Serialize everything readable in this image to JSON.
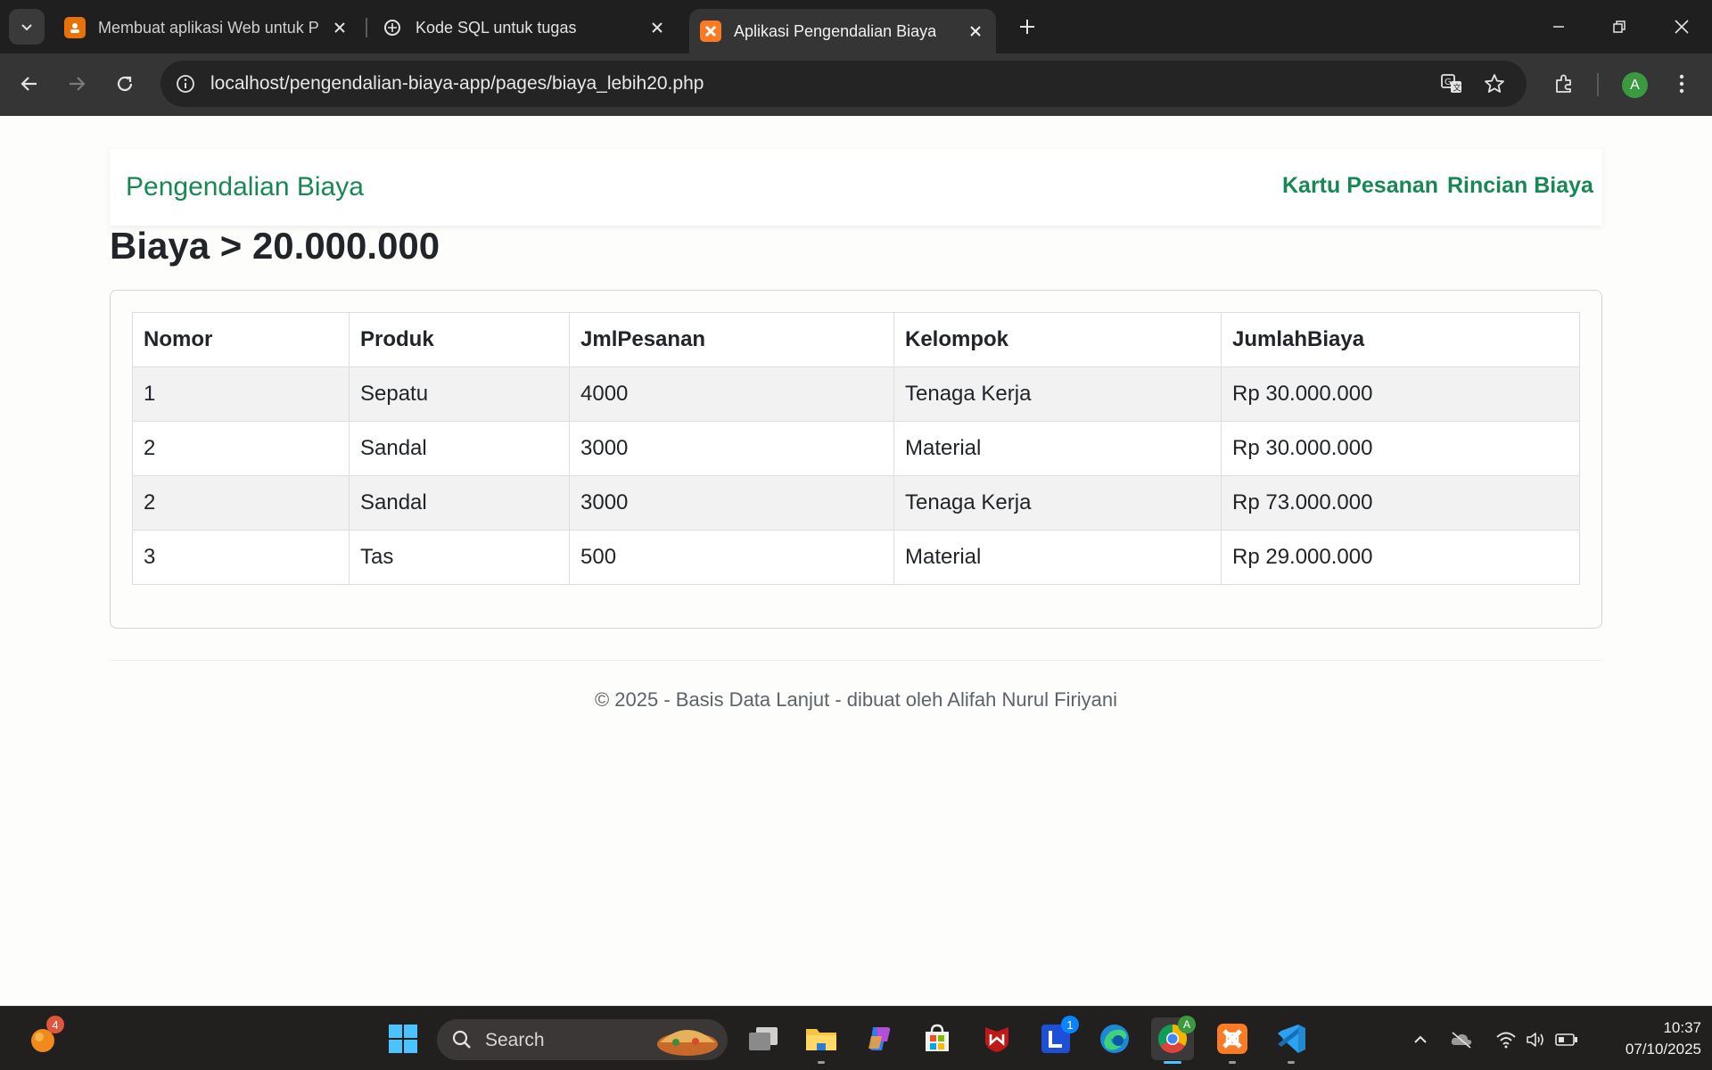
{
  "browser": {
    "tabs": [
      {
        "title": "Membuat aplikasi Web untuk P",
        "favicon": "slides-icon",
        "active": false
      },
      {
        "title": "Kode SQL untuk tugas",
        "favicon": "chatgpt-icon",
        "active": false
      },
      {
        "title": "Aplikasi Pengendalian Biaya",
        "favicon": "xampp-icon",
        "active": true
      }
    ],
    "url": "localhost/pengendalian-biaya-app/pages/biaya_lebih20.php",
    "profile_initial": "A"
  },
  "page": {
    "brand": "Pengendalian Biaya",
    "nav": [
      "Kartu Pesanan",
      "Rincian Biaya"
    ],
    "title": "Biaya > 20.000.000",
    "table": {
      "headers": [
        "Nomor",
        "Produk",
        "JmlPesanan",
        "Kelompok",
        "JumlahBiaya"
      ],
      "rows": [
        [
          "1",
          "Sepatu",
          "4000",
          "Tenaga Kerja",
          "Rp 30.000.000"
        ],
        [
          "2",
          "Sandal",
          "3000",
          "Material",
          "Rp 30.000.000"
        ],
        [
          "2",
          "Sandal",
          "3000",
          "Tenaga Kerja",
          "Rp 73.000.000"
        ],
        [
          "3",
          "Tas",
          "500",
          "Material",
          "Rp 29.000.000"
        ]
      ]
    },
    "footer": "© 2025 - Basis Data Lanjut - dibuat oleh Alifah Nurul Firiyani"
  },
  "taskbar": {
    "search_placeholder": "Search",
    "widgets_badge": "4",
    "l_app_badge": "1",
    "time": "10:37",
    "date": "07/10/2025"
  },
  "colors": {
    "accent": "#198754",
    "chrome_dark": "#1f1f1f",
    "chrome_toolbar": "#353535"
  }
}
